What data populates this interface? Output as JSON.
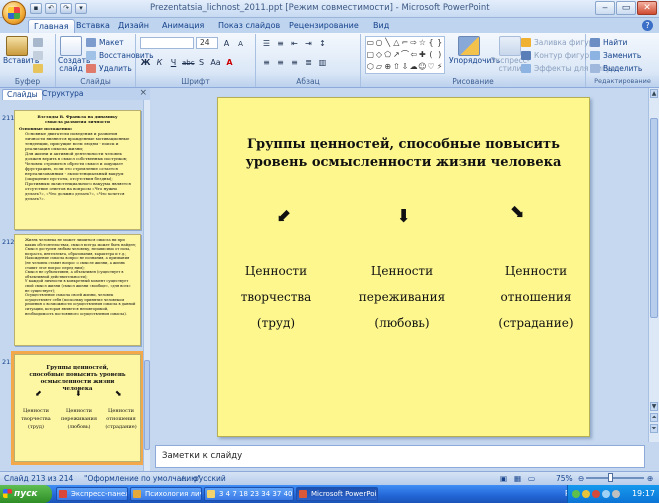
{
  "window": {
    "title": "Prezentatsia_lichnost_2011.ppt [Режим совместимости] - Microsoft PowerPoint",
    "minimize": "‒",
    "maximize": "▭",
    "close": "✕"
  },
  "tabs": [
    "Главная",
    "Вставка",
    "Дизайн",
    "Анимация",
    "Показ слайдов",
    "Рецензирование",
    "Вид"
  ],
  "ribbon": {
    "clipboard": {
      "paste": "Вставить",
      "label": "Буфер обмена"
    },
    "slides": {
      "new_slide": "Создать слайд",
      "layout": "Макет",
      "reset": "Восстановить",
      "delete": "Удалить",
      "label": "Слайды"
    },
    "font": {
      "size": "24",
      "label": "Шрифт",
      "bold": "Ж",
      "italic": "К",
      "underline": "Ч",
      "strike": "abc",
      "shadow": "S",
      "case": "Аа",
      "color": "А"
    },
    "paragraph": {
      "label": "Абзац"
    },
    "drawing": {
      "arrange": "Упорядочить",
      "quick_styles": "Экспресс-стили",
      "fill": "Заливка фигуры",
      "outline": "Контур фигуры",
      "effects": "Эффекты для фигур",
      "label": "Рисование"
    },
    "editing": {
      "find": "Найти",
      "replace": "Заменить",
      "select": "Выделить",
      "label": "Редактирование"
    }
  },
  "left_pane": {
    "tab_slides": "Слайды",
    "tab_outline": "Структура",
    "close": "×",
    "thumbs": [
      {
        "num": "211",
        "title": "Взгляды В. Франкла на динамику смысла развития личности",
        "heading": "Основные положения:",
        "items": [
          "Основные двигатели поведения и развития личности являются врожденные мотивационные тенденции, присущие всем людям - поиск и реализация смысла жизни;",
          "Для жизни и активной деятельности человек должен верить в смысл собственных поступков;",
          "Человек стремится обрести смысл и ощущает фрустрацию, если это стремление остается нереализованным - экзистенциальный вакуум (ощущение пустоты, отсутствия бездны);",
          "Противным экзистенциального вакуума является отсутствие ответов на вопросы «Что нужно делать?», «Что должно делать?», «Что хочется делать?»."
        ]
      },
      {
        "num": "212",
        "items": [
          "Жизнь человека не может лишиться смысла ни при каких обстоятельствах, смысл всегда может быть найден;",
          "Смысл доступен любым человеку, независимо от пола, возраста, интеллекта, образования, характера и т.д.;",
          "Нахождение смысла вопрос не познания, а призвания (не человек ставит вопрос о смысле жизни, а жизнь ставит этот вопрос перед ним);",
          "Смысл не субъективен, а объективен (существует в объективной действительности);",
          "У каждой личности в конкретный момент существует свой смысл жизни (смысл жизни «вообще», «для всех» не существует);",
          "Осуществление смысла своей жизни, человек осуществляет себя (поскольку принятие человеком решения о возможности осуществления смысла в данной ситуации, которая является неповторимой, необходимость постоянного осуществления смысла)."
        ]
      },
      {
        "num": "213",
        "title": "Группы ценностей, способные повысить уровень осмысленности жизни человека",
        "columns": [
          [
            "Ценности",
            "творчества",
            "(труд)"
          ],
          [
            "Ценности",
            "переживания",
            "(любовь)"
          ],
          [
            "Ценности",
            "отношения",
            "(страдание)"
          ]
        ]
      }
    ]
  },
  "slide": {
    "title": "Группы ценностей, способные повысить уровень осмысленности жизни человека",
    "columns": [
      {
        "arrow": "⬋",
        "lines": [
          "Ценности",
          "творчества",
          "(труд)"
        ]
      },
      {
        "arrow": "⬇",
        "lines": [
          "Ценности",
          "переживания",
          "(любовь)"
        ]
      },
      {
        "arrow": "⬊",
        "lines": [
          "Ценности",
          "отношения",
          "(страдание)"
        ]
      }
    ]
  },
  "notes_placeholder": "Заметки к слайду",
  "status": {
    "slide_count": "Слайд 213 из 214",
    "theme": "\"Оформление по умолчанию\"",
    "language": "русский",
    "zoom": "75%"
  },
  "taskbar": {
    "start": "пуск",
    "tasks": [
      "Экспресс-панель - О...",
      "Психология личност...",
      "3 4 7 18 23 34 37 40 ...",
      "Microsoft PowerPoint ..."
    ],
    "lang": "RU",
    "clock": "19:17"
  }
}
